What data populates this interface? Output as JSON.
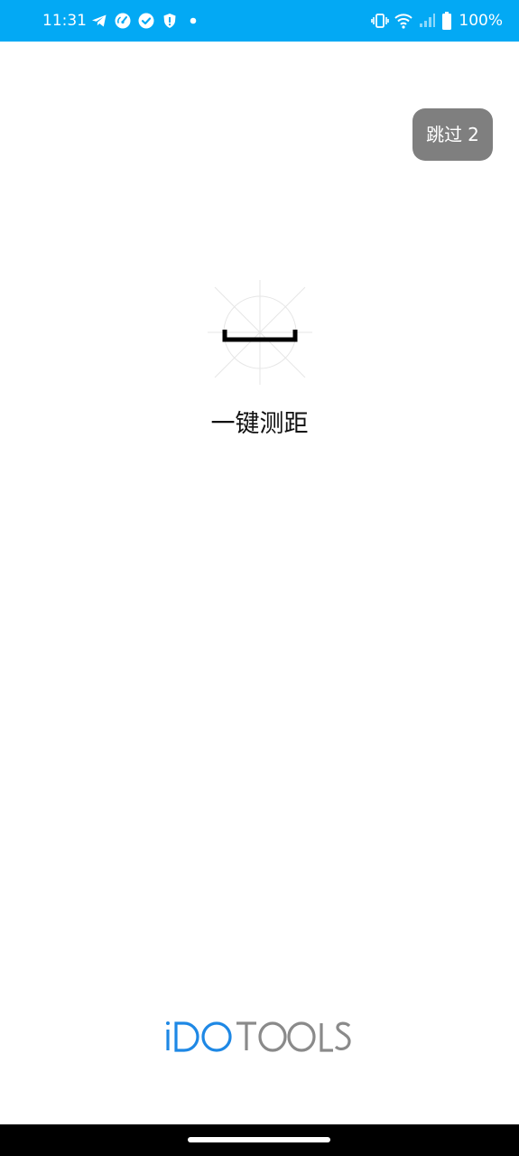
{
  "status_bar": {
    "time": "11:31",
    "battery_percent": "100%",
    "left_icons": [
      "telegram-icon",
      "speedometer-icon",
      "check-circle-icon",
      "shield-alert-icon",
      "dot-icon"
    ],
    "right_icons": [
      "vibrate-icon",
      "wifi-icon",
      "cell-signal-icon",
      "battery-icon"
    ],
    "background_color": "#03a9f4"
  },
  "skip_button": {
    "label": "跳过",
    "countdown": "2",
    "background_color": "#7f7f7f"
  },
  "feature": {
    "icon": "measure-distance-icon",
    "title": "一键测距"
  },
  "brand": {
    "logo_text": "iDOTOOLS",
    "accent_part": "iDO",
    "gray_part": "TOOLS",
    "accent_color": "#1e88e5",
    "gray_color": "#8a8a8a"
  },
  "nav_bar": {
    "background_color": "#000000"
  }
}
